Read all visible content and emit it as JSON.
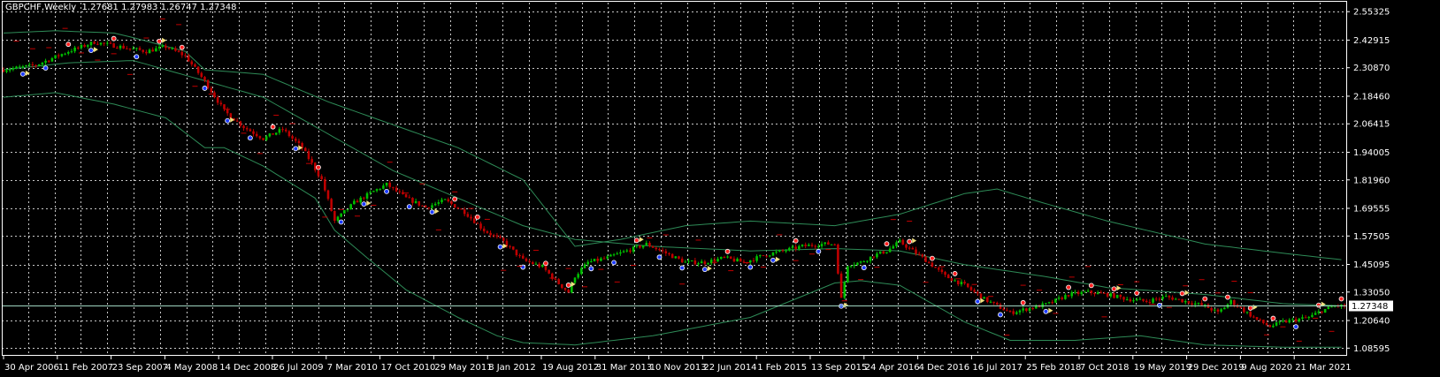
{
  "header": {
    "symbol_tf": "GBPCHF,Weekly",
    "ohlc": "1.27681 1.27983 1.26747 1.27348"
  },
  "colors": {
    "background": "#000000",
    "grid": "#c8c8c8",
    "bull": "#00c000",
    "bear": "#c00000",
    "band": "#2e8b57",
    "axis_text": "#ffffff",
    "current_price_line": "#9fd4c0",
    "marker_up": "#1e3cff",
    "marker_down": "#ff2020",
    "marker_flag": "#f0e080"
  },
  "chart_data": {
    "type": "candlestick",
    "title": "GBPCHF,Weekly",
    "ylim": [
      1.0525,
      2.5925
    ],
    "y_ticks": [
      "2.55325",
      "2.42915",
      "2.30870",
      "2.18460",
      "2.06415",
      "1.94005",
      "1.81960",
      "1.69555",
      "1.57505",
      "1.45095",
      "1.33050",
      "1.20640",
      "1.08595"
    ],
    "x_ticks": [
      "30 Apr 2006",
      "11 Feb 2007",
      "23 Sep 2007",
      "4 May 2008",
      "14 Dec 2008",
      "26 Jul 2009",
      "7 Mar 2010",
      "17 Oct 2010",
      "29 May 2011",
      "8 Jan 2012",
      "19 Aug 2012",
      "31 Mar 2013",
      "10 Nov 2013",
      "22 Jun 2014",
      "1 Feb 2015",
      "13 Sep 2015",
      "24 Apr 2016",
      "4 Dec 2016",
      "16 Jul 2017",
      "25 Feb 2018",
      "7 Oct 2018",
      "19 May 2019",
      "29 Dec 2019",
      "9 Aug 2020",
      "21 Mar 2021"
    ],
    "current_price": "1.27348",
    "price_path": [
      [
        0,
        2.3
      ],
      [
        10,
        2.32
      ],
      [
        20,
        2.38
      ],
      [
        28,
        2.42
      ],
      [
        36,
        2.4
      ],
      [
        44,
        2.38
      ],
      [
        50,
        2.4
      ],
      [
        56,
        2.36
      ],
      [
        62,
        2.25
      ],
      [
        68,
        2.12
      ],
      [
        74,
        2.05
      ],
      [
        80,
        2.0
      ],
      [
        86,
        2.04
      ],
      [
        92,
        1.96
      ],
      [
        98,
        1.82
      ],
      [
        102,
        1.64
      ],
      [
        108,
        1.72
      ],
      [
        114,
        1.77
      ],
      [
        118,
        1.8
      ],
      [
        124,
        1.74
      ],
      [
        130,
        1.7
      ],
      [
        136,
        1.73
      ],
      [
        142,
        1.68
      ],
      [
        148,
        1.6
      ],
      [
        154,
        1.55
      ],
      [
        160,
        1.47
      ],
      [
        166,
        1.44
      ],
      [
        170,
        1.38
      ],
      [
        174,
        1.33
      ],
      [
        176,
        1.4
      ],
      [
        180,
        1.46
      ],
      [
        186,
        1.48
      ],
      [
        192,
        1.51
      ],
      [
        198,
        1.54
      ],
      [
        204,
        1.5
      ],
      [
        210,
        1.46
      ],
      [
        216,
        1.46
      ],
      [
        222,
        1.48
      ],
      [
        228,
        1.46
      ],
      [
        234,
        1.49
      ],
      [
        240,
        1.51
      ],
      [
        246,
        1.53
      ],
      [
        252,
        1.54
      ],
      [
        256,
        1.54
      ],
      [
        258,
        1.3
      ],
      [
        260,
        1.45
      ],
      [
        264,
        1.46
      ],
      [
        268,
        1.49
      ],
      [
        272,
        1.51
      ],
      [
        276,
        1.55
      ],
      [
        280,
        1.51
      ],
      [
        284,
        1.47
      ],
      [
        290,
        1.4
      ],
      [
        296,
        1.36
      ],
      [
        302,
        1.3
      ],
      [
        306,
        1.27
      ],
      [
        310,
        1.24
      ],
      [
        316,
        1.26
      ],
      [
        322,
        1.28
      ],
      [
        328,
        1.32
      ],
      [
        334,
        1.33
      ],
      [
        340,
        1.32
      ],
      [
        346,
        1.3
      ],
      [
        352,
        1.29
      ],
      [
        358,
        1.31
      ],
      [
        364,
        1.29
      ],
      [
        370,
        1.27
      ],
      [
        374,
        1.24
      ],
      [
        378,
        1.29
      ],
      [
        382,
        1.25
      ],
      [
        386,
        1.21
      ],
      [
        390,
        1.18
      ],
      [
        394,
        1.2
      ],
      [
        398,
        1.21
      ],
      [
        402,
        1.22
      ],
      [
        406,
        1.25
      ],
      [
        410,
        1.27
      ],
      [
        413,
        1.27
      ]
    ],
    "upper_band": [
      [
        0,
        2.46
      ],
      [
        16,
        2.47
      ],
      [
        34,
        2.46
      ],
      [
        40,
        2.44
      ],
      [
        56,
        2.38
      ],
      [
        62,
        2.3
      ],
      [
        80,
        2.28
      ],
      [
        100,
        2.16
      ],
      [
        120,
        2.06
      ],
      [
        140,
        1.96
      ],
      [
        160,
        1.82
      ],
      [
        176,
        1.53
      ],
      [
        190,
        1.56
      ],
      [
        210,
        1.62
      ],
      [
        230,
        1.64
      ],
      [
        256,
        1.62
      ],
      [
        276,
        1.67
      ],
      [
        296,
        1.76
      ],
      [
        306,
        1.78
      ],
      [
        320,
        1.72
      ],
      [
        340,
        1.64
      ],
      [
        370,
        1.54
      ],
      [
        394,
        1.5
      ],
      [
        413,
        1.47
      ]
    ],
    "middle_band": [
      [
        0,
        2.3
      ],
      [
        20,
        2.33
      ],
      [
        40,
        2.34
      ],
      [
        60,
        2.26
      ],
      [
        80,
        2.18
      ],
      [
        100,
        2.02
      ],
      [
        120,
        1.86
      ],
      [
        140,
        1.74
      ],
      [
        160,
        1.62
      ],
      [
        176,
        1.56
      ],
      [
        200,
        1.53
      ],
      [
        230,
        1.51
      ],
      [
        256,
        1.52
      ],
      [
        276,
        1.51
      ],
      [
        296,
        1.45
      ],
      [
        320,
        1.4
      ],
      [
        340,
        1.35
      ],
      [
        370,
        1.32
      ],
      [
        394,
        1.28
      ],
      [
        413,
        1.27
      ]
    ],
    "lower_band": [
      [
        0,
        2.18
      ],
      [
        16,
        2.2
      ],
      [
        34,
        2.15
      ],
      [
        50,
        2.09
      ],
      [
        62,
        1.96
      ],
      [
        68,
        1.96
      ],
      [
        80,
        1.88
      ],
      [
        96,
        1.74
      ],
      [
        102,
        1.6
      ],
      [
        112,
        1.48
      ],
      [
        124,
        1.34
      ],
      [
        140,
        1.22
      ],
      [
        152,
        1.14
      ],
      [
        160,
        1.11
      ],
      [
        176,
        1.1
      ],
      [
        200,
        1.14
      ],
      [
        230,
        1.22
      ],
      [
        256,
        1.37
      ],
      [
        264,
        1.38
      ],
      [
        276,
        1.36
      ],
      [
        296,
        1.2
      ],
      [
        310,
        1.12
      ],
      [
        330,
        1.12
      ],
      [
        350,
        1.14
      ],
      [
        370,
        1.1
      ],
      [
        394,
        1.09
      ],
      [
        413,
        1.09
      ]
    ]
  }
}
